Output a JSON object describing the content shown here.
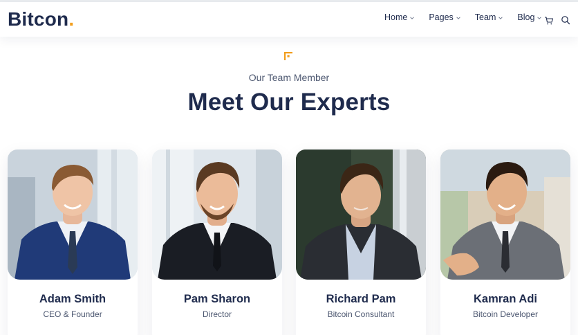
{
  "brand": {
    "name": "Bitcon",
    "dot": ".",
    "accent_color": "#f29e1d",
    "text_color": "#1f2b4d"
  },
  "nav": {
    "items": [
      {
        "label": "Home"
      },
      {
        "label": "Pages"
      },
      {
        "label": "Team"
      },
      {
        "label": "Blog"
      }
    ],
    "icons": [
      "cart-icon",
      "search-icon"
    ]
  },
  "section": {
    "eyebrow": "Our Team Member",
    "title": "Meet Our Experts"
  },
  "team": [
    {
      "name": "Adam Smith",
      "role": "CEO & Founder"
    },
    {
      "name": "Pam Sharon",
      "role": "Director"
    },
    {
      "name": "Richard Pam",
      "role": "Bitcoin Consultant"
    },
    {
      "name": "Kamran Adi",
      "role": "Bitcoin Developer"
    }
  ]
}
